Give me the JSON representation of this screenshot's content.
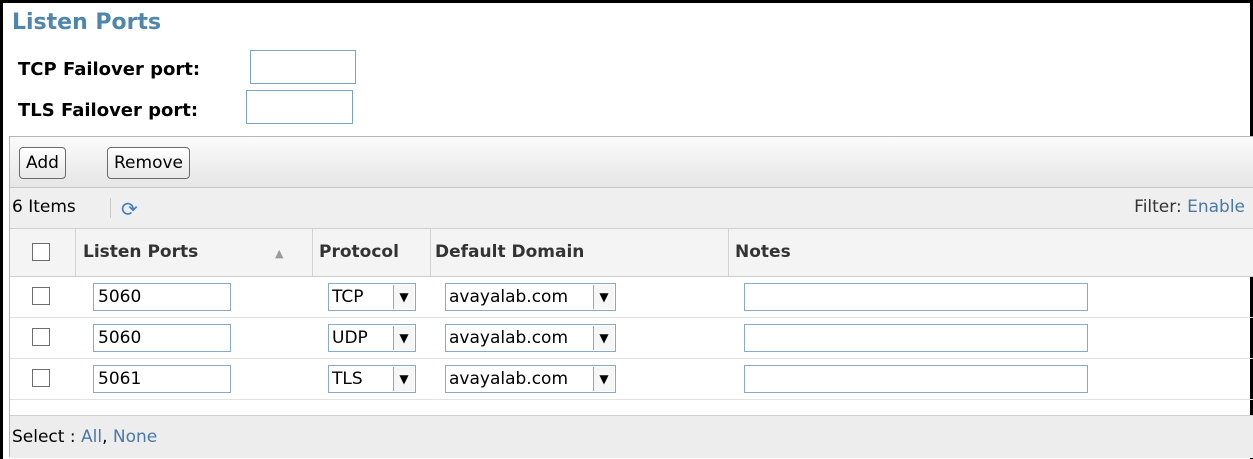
{
  "title": "Listen Ports",
  "failover": {
    "tcp_label": "TCP Failover port:",
    "tcp_value": "",
    "tls_label": "TLS Failover port:",
    "tls_value": ""
  },
  "toolbar": {
    "add_label": "Add",
    "remove_label": "Remove"
  },
  "info": {
    "count": "6 Items",
    "refresh_icon": "refresh-icon",
    "filter_label": "Filter:",
    "filter_link": "Enable"
  },
  "table": {
    "columns": [
      "Listen Ports",
      "Protocol",
      "Default Domain",
      "Notes"
    ],
    "rows": [
      {
        "port": "5060",
        "protocol": "TCP",
        "domain": "avayalab.com",
        "notes": ""
      },
      {
        "port": "5060",
        "protocol": "UDP",
        "domain": "avayalab.com",
        "notes": ""
      },
      {
        "port": "5061",
        "protocol": "TLS",
        "domain": "avayalab.com",
        "notes": ""
      }
    ]
  },
  "footer": {
    "select_label": "Select :",
    "all_link": "All",
    "none_link": "None"
  },
  "colors": {
    "title": "#4f86aa",
    "link": "#4a78a8"
  }
}
